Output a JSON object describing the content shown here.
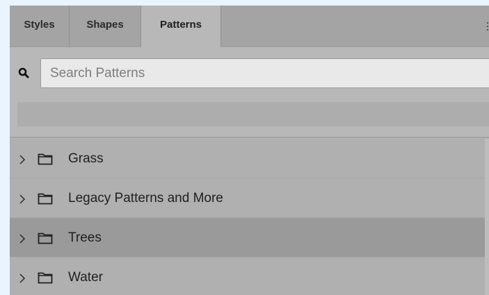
{
  "tabs": [
    {
      "label": "Styles",
      "active": false
    },
    {
      "label": "Shapes",
      "active": false
    },
    {
      "label": "Patterns",
      "active": true
    }
  ],
  "search": {
    "placeholder": "Search Patterns",
    "value": "",
    "icon": "search-icon"
  },
  "folders": [
    {
      "label": "Grass",
      "selected": false
    },
    {
      "label": "Legacy Patterns and More",
      "selected": false
    },
    {
      "label": "Trees",
      "selected": true
    },
    {
      "label": "Water",
      "selected": false
    }
  ],
  "colors": {
    "panel": "#b8b8b8",
    "tabbar": "#a4a4a4",
    "selected_row": "#9a9a9a",
    "background": "#eaf4ff"
  }
}
